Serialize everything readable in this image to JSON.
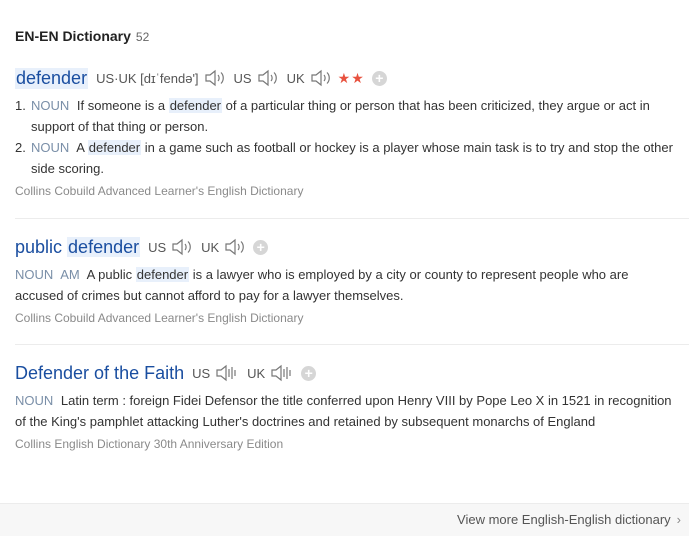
{
  "header": {
    "title": "EN-EN Dictionary",
    "count": "52"
  },
  "entries": [
    {
      "headword": "defender",
      "pron": [
        {
          "label": "US·UK [dɪˈfendə']"
        },
        {
          "label": "US"
        },
        {
          "label": "UK"
        }
      ],
      "stars": "★★",
      "defs": [
        {
          "num": "1.",
          "pos": "NOUN",
          "pre": "If someone is a",
          "hl": "defender",
          "post": "of a particular thing or person that has been criticized, they argue or act in support of that thing or person."
        },
        {
          "num": "2.",
          "pos": "NOUN",
          "pre": "A",
          "hl": "defender",
          "post": "in a game such as football or hockey is a player whose main task is to try and stop the other side scoring."
        }
      ],
      "source": "Collins Cobuild Advanced Learner's English Dictionary"
    },
    {
      "headword_pre": "public",
      "headword_hl": "defender",
      "pron": [
        {
          "label": "US"
        },
        {
          "label": "UK"
        }
      ],
      "def": {
        "pos": "NOUN",
        "region": "AM",
        "pre": "A public",
        "hl": "defender",
        "post": "is a lawyer who is employed by a city or county to represent people who are accused of crimes but cannot afford to pay for a lawyer themselves."
      },
      "source": "Collins Cobuild Advanced Learner's English Dictionary"
    },
    {
      "headword": "Defender of the Faith",
      "pron": [
        {
          "label": "US"
        },
        {
          "label": "UK"
        }
      ],
      "def": {
        "pos": "NOUN",
        "text": "Latin term : foreign Fidei Defensor the title conferred upon Henry VIII by Pope Leo X in 1521 in recognition of the King's pamphlet attacking Luther's doctrines and retained by subsequent monarchs of England"
      },
      "source": "Collins English Dictionary 30th Anniversary Edition"
    }
  ],
  "footer": {
    "more_label": "View more English-English dictionary"
  },
  "icons": {
    "speaker": "speaker-icon",
    "add": "plus-icon",
    "chevron": "chevron-right-icon"
  },
  "colors": {
    "link": "#1a4ea0",
    "star": "#e8523f",
    "highlight": "#e8f0fb"
  }
}
